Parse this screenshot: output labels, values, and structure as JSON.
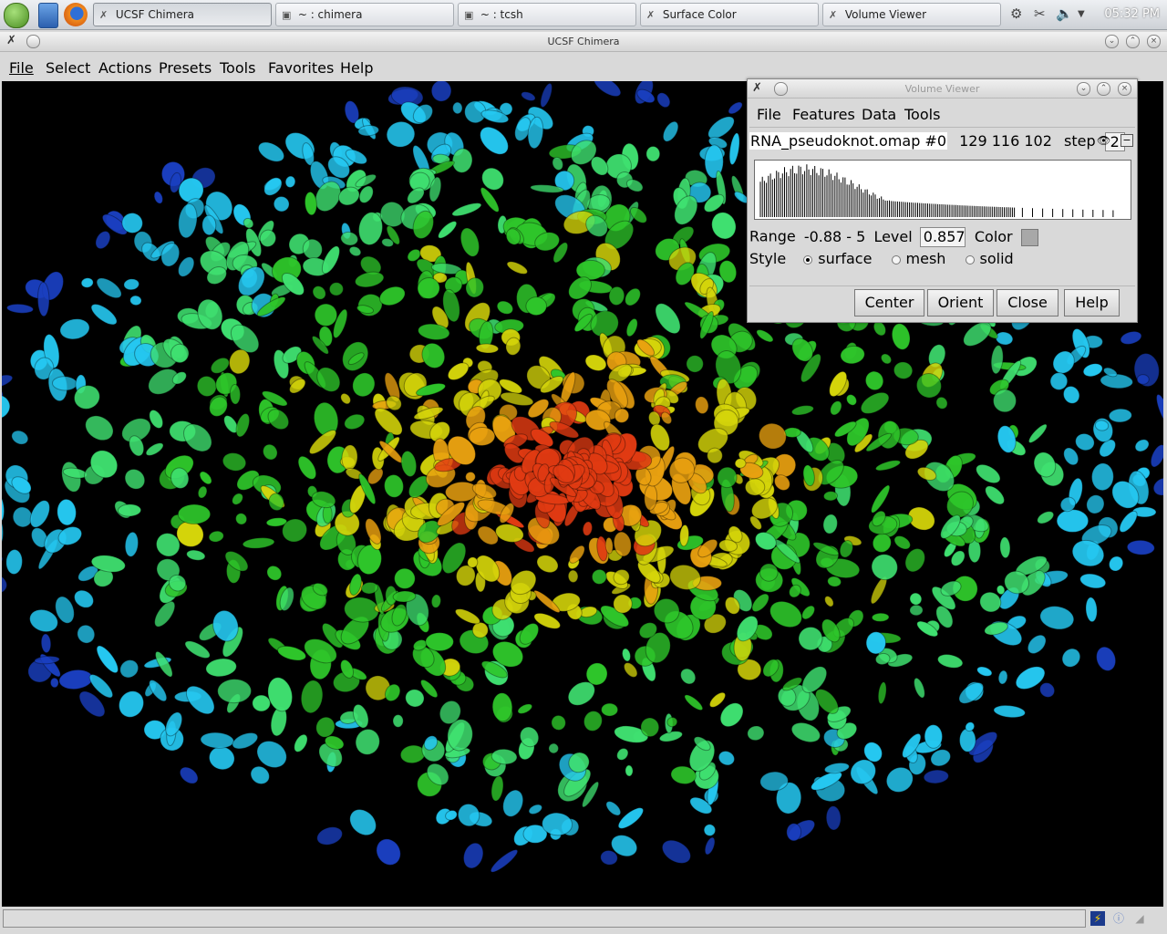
{
  "taskbar": {
    "tasks": [
      {
        "label": "UCSF Chimera",
        "icon": "chimera-icon"
      },
      {
        "label": "~ : chimera",
        "icon": "terminal-icon"
      },
      {
        "label": "~ : tcsh",
        "icon": "terminal-icon"
      },
      {
        "label": "Surface Color",
        "icon": "chimera-icon"
      },
      {
        "label": "Volume Viewer",
        "icon": "chimera-icon"
      }
    ],
    "clock": "05:32 PM"
  },
  "window": {
    "title": "UCSF Chimera"
  },
  "menubar": {
    "items": [
      "File",
      "Select",
      "Actions",
      "Presets",
      "Tools",
      "Favorites",
      "Help"
    ]
  },
  "volume_viewer": {
    "title": "Volume Viewer",
    "menu": [
      "File",
      "Features",
      "Data",
      "Tools"
    ],
    "dataset_name": "RNA_pseudoknot.omap #0",
    "dimensions": "129 116 102",
    "step_label": "step",
    "step_value": "2",
    "range_label": "Range",
    "range_value": "-0.88 - 5",
    "level_label": "Level",
    "level_value": "0.857",
    "color_label": "Color",
    "surface_color": "#a8a8a8",
    "style_label": "Style",
    "style_options": [
      "surface",
      "mesh",
      "solid"
    ],
    "style_selected": "surface",
    "buttons": [
      "Center",
      "Orient",
      "Close",
      "Help"
    ]
  },
  "colors": {
    "viewport_background": "#000000",
    "density_ramp": [
      "#1a3fbf",
      "#25c7f0",
      "#3fe070",
      "#2ec52a",
      "#d4d40a",
      "#e8a010",
      "#e03a12"
    ]
  }
}
